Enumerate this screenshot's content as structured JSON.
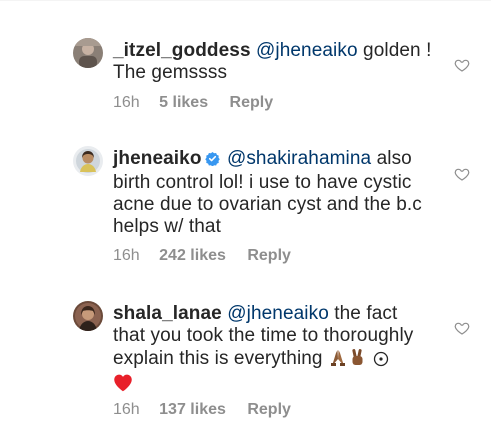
{
  "comments": [
    {
      "username": "_itzel_goddess",
      "verified": false,
      "mention": "@jheneaiko",
      "text_line1_rest": " golden !",
      "text_line2": "The gemssss",
      "time": "16h",
      "likes": "5 likes",
      "reply": "Reply",
      "avatar_icon": "avatar-photo-icon",
      "like_icon": "heart-outline-icon"
    },
    {
      "username": "jheneaiko",
      "verified": true,
      "mention": "@shakirahamina",
      "text_line1_rest": " also",
      "text_line2": "birth control lol!  i use to have cystic",
      "text_line3": "acne due to ovarian cyst and the b.c",
      "text_line4": "helps w/ that",
      "time": "16h",
      "likes": "242 likes",
      "reply": "Reply",
      "avatar_icon": "avatar-photo-icon",
      "verified_icon": "verified-badge-icon",
      "like_icon": "heart-outline-icon"
    },
    {
      "username": "shala_lanae",
      "verified": false,
      "mention": "@jheneaiko",
      "text_line1_rest": " the fact",
      "text_line2": "that you took the time to thoroughly",
      "text_line3": "explain this is everything",
      "emojis": [
        "folded-hands-icon",
        "victory-hand-icon",
        "sun-symbol-icon",
        "red-heart-icon"
      ],
      "time": "16h",
      "likes": "137 likes",
      "reply": "Reply",
      "avatar_icon": "avatar-photo-icon",
      "like_icon": "heart-outline-icon"
    }
  ],
  "colors": {
    "text": "#262626",
    "mention": "#00376b",
    "meta": "#8e8e8e",
    "verified": "#3897f0",
    "heart_outline": "#8e8e8e",
    "red_heart": "#e8202a"
  }
}
